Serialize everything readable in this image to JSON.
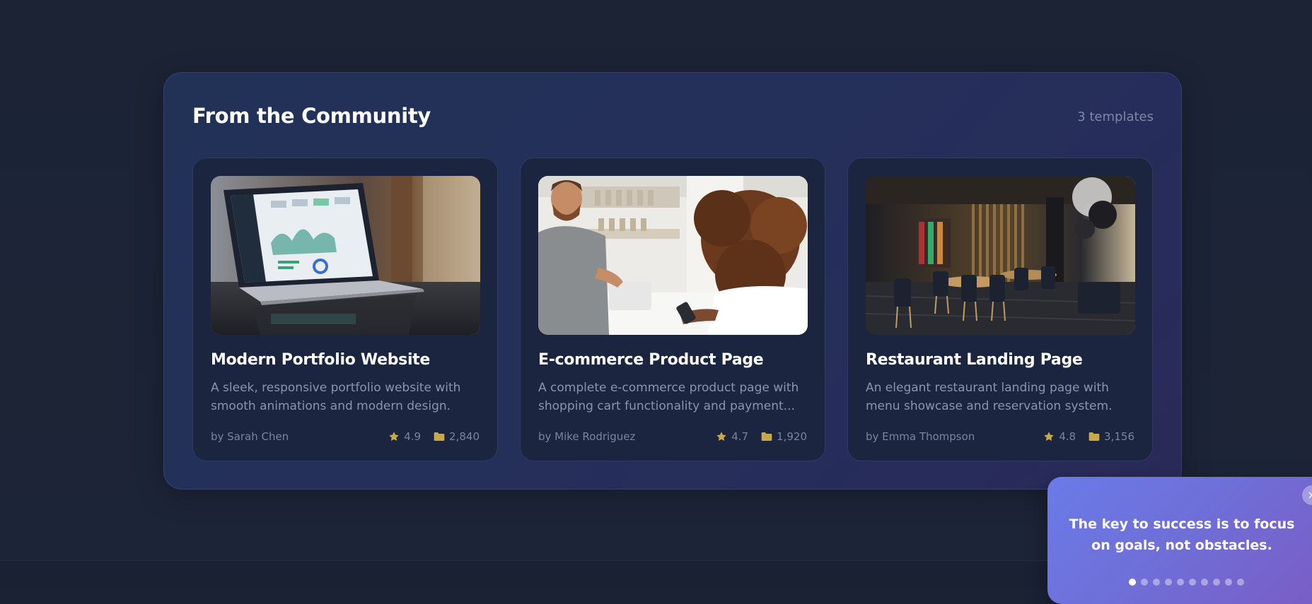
{
  "section": {
    "title": "From the Community",
    "count": "3 templates"
  },
  "cards": [
    {
      "title": "Modern Portfolio Website",
      "description": "A sleek, responsive portfolio website with smooth animations and modern design.",
      "author": "by Sarah Chen",
      "rating": "4.9",
      "uses": "2,840",
      "image": "laptop-dashboard-photo"
    },
    {
      "title": "E-commerce Product Page",
      "description": "A complete e-commerce product page with shopping cart functionality and payment...",
      "author": "by Mike Rodriguez",
      "rating": "4.7",
      "uses": "1,920",
      "image": "shop-checkout-photo"
    },
    {
      "title": "Restaurant Landing Page",
      "description": "An elegant restaurant landing page with menu showcase and reservation system.",
      "author": "by Emma Thompson",
      "rating": "4.8",
      "uses": "3,156",
      "image": "restaurant-interior-photo"
    }
  ],
  "toast": {
    "close_label": "×",
    "quote": "The key to success is to focus on goals, not obstacles.",
    "dots_total": 10,
    "dots_active": 0
  },
  "icons": {
    "rating": "star-icon",
    "uses": "folder-icon"
  },
  "colors": {
    "background": "#1a2234",
    "panel": "#24305a",
    "card": "#1b2540",
    "accent_gold": "#c9a84c",
    "toast_start": "#6a7be8",
    "toast_end": "#7a5cc4"
  }
}
